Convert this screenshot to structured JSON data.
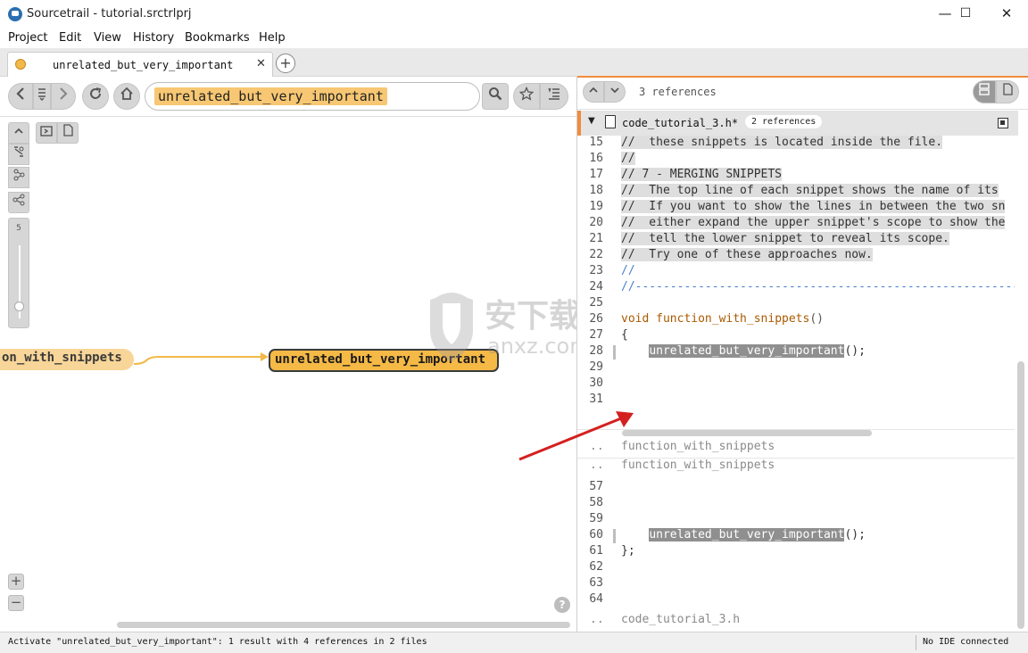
{
  "window": {
    "title": "Sourcetrail - tutorial.srctrlprj",
    "minimize": "—",
    "maximize": "☐",
    "close": "✕"
  },
  "menu": [
    "Project",
    "Edit",
    "View",
    "History",
    "Bookmarks",
    "Help"
  ],
  "tab": {
    "label": "unrelated_but_very_important",
    "close": "✕",
    "add": "+"
  },
  "search": {
    "query": "unrelated_but_very_important"
  },
  "graph": {
    "depth": "5",
    "nodes": {
      "caller": "on_with_snippets",
      "active": "unrelated_but_very_important"
    }
  },
  "code_view": {
    "references": "3 references",
    "file": {
      "name": "code_tutorial_3.h*",
      "refs": "2 references"
    },
    "lines": [
      {
        "n": "15",
        "text": "//  these snippets is located inside the file."
      },
      {
        "n": "16",
        "text": "//"
      },
      {
        "n": "17",
        "text": "// 7 - MERGING SNIPPETS"
      },
      {
        "n": "18",
        "text": "//  The top line of each snippet shows the name of its"
      },
      {
        "n": "19",
        "text": "//  If you want to show the lines in between the two sn"
      },
      {
        "n": "20",
        "text": "//  either expand the upper snippet's scope to show the"
      },
      {
        "n": "21",
        "text": "//  tell the lower snippet to reveal its scope."
      },
      {
        "n": "22",
        "text": "//  Try one of these approaches now."
      },
      {
        "n": "23",
        "text": "//"
      },
      {
        "n": "24",
        "text": "//----------------------------------------------------------"
      },
      {
        "n": "25",
        "text": ""
      },
      {
        "n": "26",
        "kw": "void",
        "fn": "function_with_snippets",
        "rest": "()"
      },
      {
        "n": "27",
        "text": "{"
      },
      {
        "n": "28",
        "call": "unrelated_but_very_important",
        "rest": "();"
      },
      {
        "n": "29",
        "text": ""
      },
      {
        "n": "30",
        "text": ""
      },
      {
        "n": "31",
        "text": ""
      }
    ],
    "scope1": {
      "dots": "..",
      "label": "function_with_snippets"
    },
    "scope2": {
      "dots": "..",
      "label": "function_with_snippets"
    },
    "lines2": [
      {
        "n": "57",
        "text": ""
      },
      {
        "n": "58",
        "text": ""
      },
      {
        "n": "59",
        "text": ""
      },
      {
        "n": "60",
        "call": "unrelated_but_very_important",
        "rest": "();"
      },
      {
        "n": "61",
        "text": "};"
      },
      {
        "n": "62",
        "text": ""
      },
      {
        "n": "63",
        "text": ""
      },
      {
        "n": "64",
        "text": ""
      }
    ],
    "footer": {
      "dots": "..",
      "label": "code_tutorial_3.h"
    }
  },
  "status": {
    "message": "Activate \"unrelated_but_very_important\": 1 result with 4 references in 2 files",
    "ide": "No IDE connected"
  },
  "watermark": {
    "text": "安下载",
    "sub": "anxz.com"
  },
  "colors": {
    "accent": "#f08c3c",
    "node_active": "#f5b946",
    "node_caller": "#f8d598",
    "annotation": "#d42020"
  }
}
